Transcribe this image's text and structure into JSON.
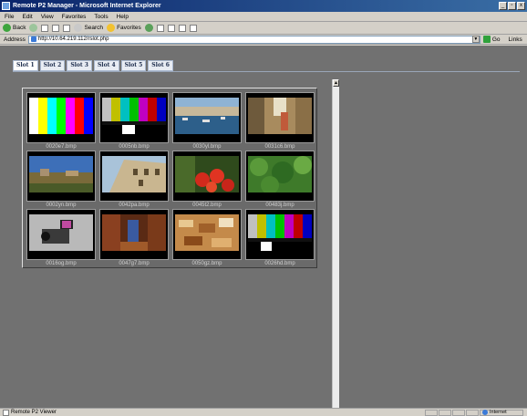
{
  "window": {
    "title": "Remote P2 Manager - Microsoft Internet Explorer"
  },
  "menu": [
    "File",
    "Edit",
    "View",
    "Favorites",
    "Tools",
    "Help"
  ],
  "toolbar": {
    "back": "Back",
    "search": "Search",
    "favorites": "Favorites"
  },
  "address": {
    "label": "Address",
    "url": "http://10.64.219.112/rslot.php",
    "go": "Go",
    "links": "Links"
  },
  "tabs": [
    "Slot 1",
    "Slot 2",
    "Slot 3",
    "Slot 4",
    "Slot 5",
    "Slot 6"
  ],
  "thumbnails": [
    {
      "file": "0020e7.bmp",
      "image": "color-bars"
    },
    {
      "file": "0005nb.bmp",
      "image": "color-bars-pluge"
    },
    {
      "file": "0030yl.bmp",
      "image": "harbor"
    },
    {
      "file": "0031c6.bmp",
      "image": "alley"
    },
    {
      "file": "0002yn.bmp",
      "image": "hilltown"
    },
    {
      "file": "0042pa.bmp",
      "image": "building"
    },
    {
      "file": "0045t2.bmp",
      "image": "tomatoes"
    },
    {
      "file": "00483j.bmp",
      "image": "forest"
    },
    {
      "file": "0016og.bmp",
      "image": "camera"
    },
    {
      "file": "0047g7.bmp",
      "image": "street-night"
    },
    {
      "file": "0050gz.bmp",
      "image": "food"
    },
    {
      "file": "0026hd.bmp",
      "image": "color-bars"
    }
  ],
  "status": {
    "text": "Remote P2 Viewer",
    "zone": "Internet"
  },
  "colors": {
    "content_bg": "#717171",
    "titlebar": "#0a246a"
  }
}
